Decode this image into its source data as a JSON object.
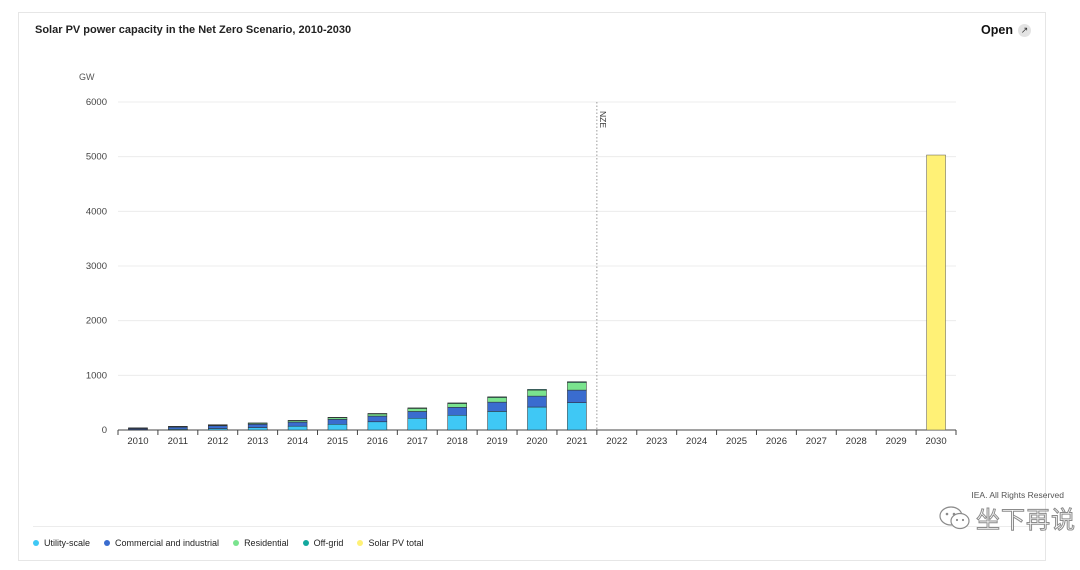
{
  "card": {
    "title": "Solar PV power capacity in the Net Zero Scenario, 2010-2030",
    "open_label": "Open",
    "open_icon": "expand-arrow-icon",
    "credit": "IEA. All Rights Reserved",
    "watermark_text": "坐下再说",
    "watermark_icon": "wechat-icon"
  },
  "legend": [
    {
      "label": "Utility-scale",
      "color": "#3fc8f5"
    },
    {
      "label": "Commercial and industrial",
      "color": "#3a6ccf"
    },
    {
      "label": "Residential",
      "color": "#7ae38e"
    },
    {
      "label": "Off-grid",
      "color": "#13a89e"
    },
    {
      "label": "Solar PV total",
      "color": "#fff176"
    }
  ],
  "chart_data": {
    "type": "bar",
    "stacked": true,
    "ylabel": "GW",
    "ylim": [
      0,
      6000
    ],
    "yticks": [
      0,
      1000,
      2000,
      3000,
      4000,
      5000,
      6000
    ],
    "grid": true,
    "legend_placement": "bottom-left",
    "categories": [
      "2010",
      "2011",
      "2012",
      "2013",
      "2014",
      "2015",
      "2016",
      "2017",
      "2018",
      "2019",
      "2020",
      "2021",
      "2022",
      "2023",
      "2024",
      "2025",
      "2026",
      "2027",
      "2028",
      "2029",
      "2030"
    ],
    "series": [
      {
        "name": "Utility-scale",
        "color": "#3fc8f5",
        "values": [
          8,
          15,
          27,
          45,
          70,
          105,
          150,
          215,
          270,
          340,
          420,
          500,
          null,
          null,
          null,
          null,
          null,
          null,
          null,
          null,
          null
        ]
      },
      {
        "name": "Commercial and industrial",
        "color": "#3a6ccf",
        "values": [
          22,
          38,
          50,
          60,
          75,
          90,
          105,
          125,
          145,
          170,
          200,
          230,
          null,
          null,
          null,
          null,
          null,
          null,
          null,
          null,
          null
        ]
      },
      {
        "name": "Residential",
        "color": "#7ae38e",
        "values": [
          7,
          10,
          15,
          20,
          25,
          30,
          40,
          55,
          70,
          85,
          110,
          140,
          null,
          null,
          null,
          null,
          null,
          null,
          null,
          null,
          null
        ]
      },
      {
        "name": "Off-grid",
        "color": "#13a89e",
        "values": [
          3,
          4,
          5,
          5,
          6,
          7,
          8,
          10,
          11,
          12,
          13,
          14,
          null,
          null,
          null,
          null,
          null,
          null,
          null,
          null,
          null
        ]
      },
      {
        "name": "Solar PV total",
        "color": "#fff176",
        "values": [
          null,
          null,
          null,
          null,
          null,
          null,
          null,
          null,
          null,
          null,
          null,
          null,
          null,
          null,
          null,
          null,
          null,
          null,
          null,
          null,
          5030
        ]
      }
    ],
    "annotations": [
      {
        "label": "NZE",
        "x": "2021.5"
      }
    ]
  }
}
